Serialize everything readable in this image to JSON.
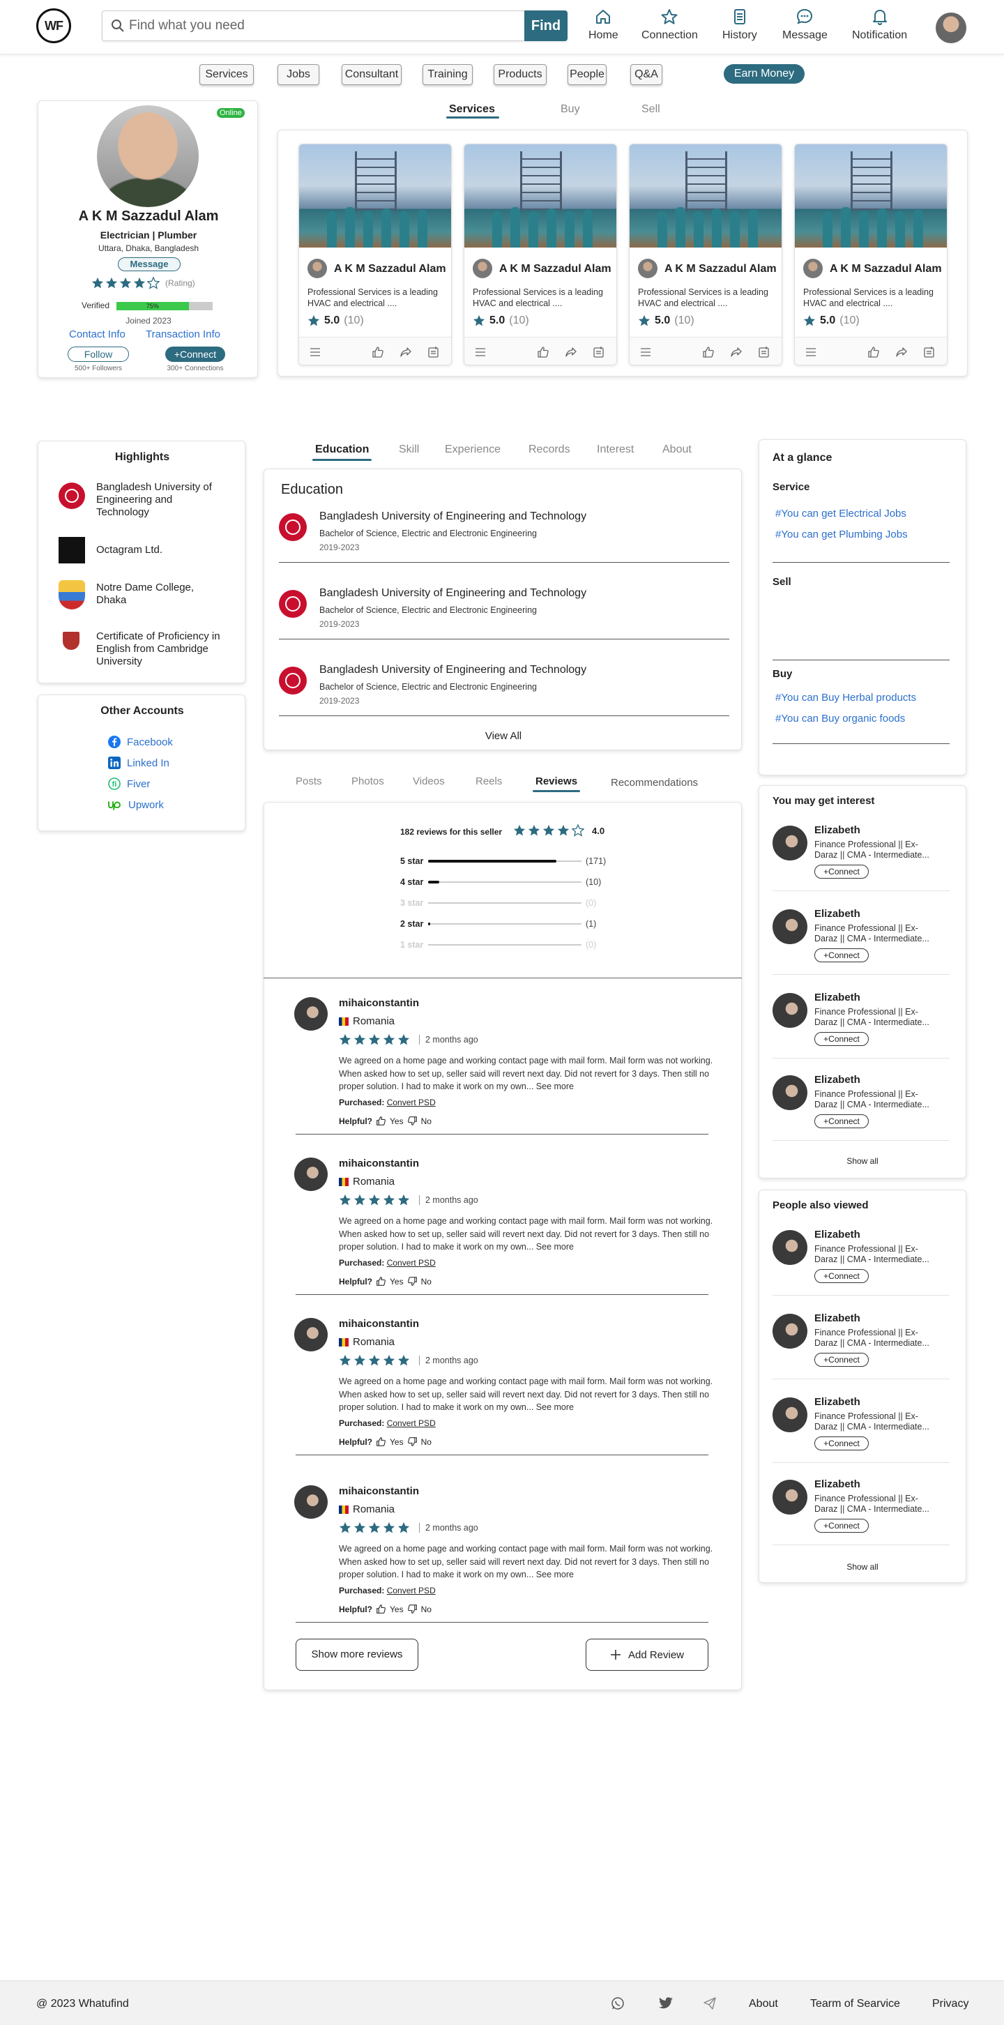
{
  "header": {
    "logo": "WF",
    "search_placeholder": "Find what you need",
    "find_label": "Find",
    "nav": [
      {
        "label": "Home",
        "icon": "home-icon"
      },
      {
        "label": "Connection",
        "icon": "star-icon"
      },
      {
        "label": "History",
        "icon": "history-icon"
      },
      {
        "label": "Message",
        "icon": "message-icon"
      },
      {
        "label": "Notification",
        "icon": "bell-icon"
      }
    ]
  },
  "categories": [
    "Services",
    "Jobs",
    "Consultant",
    "Training",
    "Products",
    "People",
    "Q&A"
  ],
  "earn_money": "Earn Money",
  "profile": {
    "status": "Online",
    "name": "A K M Sazzadul Alam",
    "title": "Electrician | Plumber",
    "location": "Uttara, Dhaka, Bangladesh",
    "message": "Message",
    "rating_label": "(Rating)",
    "rating": 4,
    "verified_label": "Verified",
    "verified_pct": 75,
    "verified_pct_label": "75%",
    "joined": "Joined 2023",
    "contact": "Contact Info",
    "transaction": "Transaction Info",
    "follow": "Follow",
    "followers": "500+ Followers",
    "connect": "+Connect",
    "connections": "300+ Connections"
  },
  "service_tabs": [
    "Services",
    "Buy",
    "Sell"
  ],
  "services": [
    {
      "name": "A K M Sazzadul Alam",
      "desc": "Professional Services is a leading HVAC and electrical ....",
      "rating": "5.0",
      "count": "(10)"
    },
    {
      "name": "A K M Sazzadul Alam",
      "desc": "Professional Services is a leading HVAC and electrical ....",
      "rating": "5.0",
      "count": "(10)"
    },
    {
      "name": "A K M Sazzadul Alam",
      "desc": "Professional Services is a leading HVAC and electrical ....",
      "rating": "5.0",
      "count": "(10)"
    },
    {
      "name": "A K M Sazzadul Alam",
      "desc": "Professional Services is a leading HVAC and electrical ....",
      "rating": "5.0",
      "count": "(10)"
    }
  ],
  "highlights": {
    "title": "Highlights",
    "items": [
      "Bangladesh University of Engineering and Technology",
      "Octagram Ltd.",
      "Notre Dame College, Dhaka",
      "Certificate of Proficiency in English from Cambridge University"
    ]
  },
  "other_accounts": {
    "title": "Other Accounts",
    "items": [
      {
        "label": "Facebook",
        "color": "#1877f2"
      },
      {
        "label": "Linked In",
        "color": "#0a66c2"
      },
      {
        "label": "Fiver",
        "color": "#1dbf73"
      },
      {
        "label": "Upwork",
        "color": "#14a800"
      }
    ]
  },
  "profile_tabs": [
    "Education",
    "Skill",
    "Experience",
    "Records",
    "Interest",
    "About"
  ],
  "education": {
    "title": "Education",
    "items": [
      {
        "school": "Bangladesh University of Engineering and Technology",
        "degree": "Bachelor of Science, Electric and Electronic Engineering",
        "years": "2019-2023"
      },
      {
        "school": "Bangladesh University of Engineering and Technology",
        "degree": "Bachelor of Science, Electric and Electronic Engineering",
        "years": "2019-2023"
      },
      {
        "school": "Bangladesh University of Engineering and Technology",
        "degree": "Bachelor of Science, Electric and Electronic Engineering",
        "years": "2019-2023"
      }
    ],
    "view_all": "View All"
  },
  "content_tabs": [
    "Posts",
    "Photos",
    "Videos",
    "Reels",
    "Reviews",
    "Recommendations"
  ],
  "reviews_summary": {
    "label": "182 reviews for this seller",
    "score": "4.0",
    "bars": [
      {
        "label": "5 star",
        "fraction": 0.92,
        "count": "(171)"
      },
      {
        "label": "4 star",
        "fraction": 0.08,
        "count": "(10)"
      },
      {
        "label": "3 star",
        "fraction": 0,
        "count": "(0)"
      },
      {
        "label": "2 star",
        "fraction": 0.01,
        "count": "(1)"
      },
      {
        "label": "1 star",
        "fraction": 0,
        "count": "(0)"
      }
    ]
  },
  "reviews": [
    {
      "user": "mihaiconstantin",
      "country": "Romania",
      "ago": "2 months ago",
      "text": "We agreed on a home page and working contact page with mail form. Mail form was not working. When asked how to set up, seller said will revert next day. Did not revert for 3 days. Then still no proper solution. I had to make it work on my own...",
      "see_more": "See more",
      "purchased_label": "Purchased:",
      "purchased": "Convert PSD",
      "helpful": "Helpful?",
      "yes": "Yes",
      "no": "No"
    },
    {
      "user": "mihaiconstantin",
      "country": "Romania",
      "ago": "2 months ago",
      "text": "We agreed on a home page and working contact page with mail form. Mail form was not working. When asked how to set up, seller said will revert next day. Did not revert for 3 days. Then still no proper solution. I had to make it work on my own...",
      "see_more": "See more",
      "purchased_label": "Purchased:",
      "purchased": "Convert PSD",
      "helpful": "Helpful?",
      "yes": "Yes",
      "no": "No"
    },
    {
      "user": "mihaiconstantin",
      "country": "Romania",
      "ago": "2 months ago",
      "text": "We agreed on a home page and working contact page with mail form. Mail form was not working. When asked how to set up, seller said will revert next day. Did not revert for 3 days. Then still no proper solution. I had to make it work on my own...",
      "see_more": "See more",
      "purchased_label": "Purchased:",
      "purchased": "Convert PSD",
      "helpful": "Helpful?",
      "yes": "Yes",
      "no": "No"
    },
    {
      "user": "mihaiconstantin",
      "country": "Romania",
      "ago": "2 months ago",
      "text": "We agreed on a home page and working contact page with mail form. Mail form was not working. When asked how to set up, seller said will revert next day. Did not revert for 3 days. Then still no proper solution. I had to make it work on my own...",
      "see_more": "See more",
      "purchased_label": "Purchased:",
      "purchased": "Convert PSD",
      "helpful": "Helpful?",
      "yes": "Yes",
      "no": "No"
    }
  ],
  "show_more_reviews": "Show more reviews",
  "add_review": "Add Review",
  "glance": {
    "title": "At a glance",
    "service_title": "Service",
    "service_links": [
      "#You can get Electrical Jobs",
      "#You can get Plumbing Jobs"
    ],
    "sell_title": "Sell",
    "buy_title": "Buy",
    "buy_links": [
      "#You can Buy Herbal products",
      "#You can Buy organic foods"
    ]
  },
  "interest": {
    "title": "You may get interest",
    "people": [
      {
        "name": "Elizabeth",
        "desc": "Finance Professional || Ex-Daraz || CMA - Intermediate...",
        "connect": "+Connect"
      },
      {
        "name": "Elizabeth",
        "desc": "Finance Professional || Ex-Daraz || CMA - Intermediate...",
        "connect": "+Connect"
      },
      {
        "name": "Elizabeth",
        "desc": "Finance Professional || Ex-Daraz || CMA - Intermediate...",
        "connect": "+Connect"
      },
      {
        "name": "Elizabeth",
        "desc": "Finance Professional || Ex-Daraz || CMA - Intermediate...",
        "connect": "+Connect"
      }
    ],
    "show_all": "Show all"
  },
  "also_viewed": {
    "title": "People also viewed",
    "people": [
      {
        "name": "Elizabeth",
        "desc": "Finance Professional || Ex-Daraz || CMA - Intermediate...",
        "connect": "+Connect"
      },
      {
        "name": "Elizabeth",
        "desc": "Finance Professional || Ex-Daraz || CMA - Intermediate...",
        "connect": "+Connect"
      },
      {
        "name": "Elizabeth",
        "desc": "Finance Professional || Ex-Daraz || CMA - Intermediate...",
        "connect": "+Connect"
      },
      {
        "name": "Elizabeth",
        "desc": "Finance Professional || Ex-Daraz || CMA - Intermediate...",
        "connect": "+Connect"
      }
    ],
    "show_all": "Show all"
  },
  "footer": {
    "copyright": "@ 2023 Whatufind",
    "about": "About",
    "terms": "Tearm of Searvice",
    "privacy": "Privacy"
  },
  "colors": {
    "accent": "#2d6b80",
    "link": "#2b6fcd",
    "online": "#2fb344",
    "star": "#2d6b80"
  }
}
